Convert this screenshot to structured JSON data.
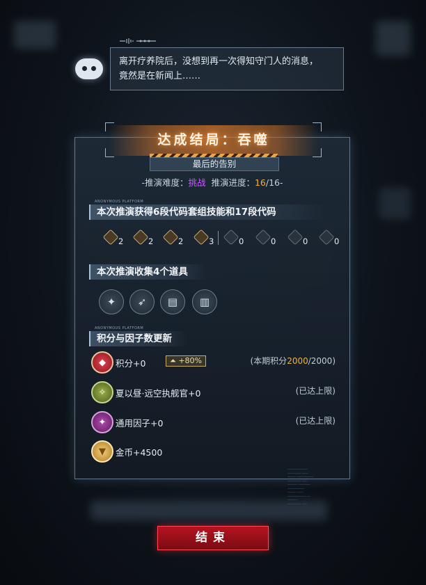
{
  "dialog": {
    "line1": "离开疗养院后，没想到再一次得知守门人的消息，",
    "line2": "竟然是在新闻上……"
  },
  "panel": {
    "title": "达成结局：吞噬",
    "subtitle": "最后的告别",
    "difficulty_label": "-推演难度：",
    "difficulty_value": "挑战",
    "progress_label": "推演进度：",
    "progress_current": "16",
    "progress_total": "/16-",
    "section_tag": "ANONYMOUS PLATFORM",
    "skills_heading": "本次推演获得6段代码套组技能和17段代码",
    "skills": [
      {
        "icon": "code-set-icon-1",
        "count": "2"
      },
      {
        "icon": "code-set-icon-2",
        "count": "2"
      },
      {
        "icon": "code-set-icon-3",
        "count": "2"
      },
      {
        "icon": "code-set-icon-4",
        "count": "3"
      },
      {
        "icon": "code-icon-5",
        "count": "0"
      },
      {
        "icon": "code-icon-6",
        "count": "0"
      },
      {
        "icon": "code-icon-7",
        "count": "0"
      },
      {
        "icon": "code-icon-8",
        "count": "0"
      }
    ],
    "items_heading": "本次推演收集4个道具",
    "items": [
      "✦",
      "➶",
      "▤",
      "▥"
    ],
    "score_heading": "积分与因子数更新",
    "score": {
      "label": "积分+0",
      "boost": "+80%",
      "period_prefix": "(本期积分",
      "period_value": "2000",
      "period_suffix": "/2000)"
    },
    "officer": {
      "label": "夏以昼·远空执舰官+0",
      "status": "(已达上限)"
    },
    "factor": {
      "label": "通用因子+0",
      "status": "(已达上限)"
    },
    "coin": {
      "label": "金币+4500"
    }
  },
  "end_button": "结束",
  "colors": {
    "accent_orange": "#f1b23e",
    "difficulty_purple": "#c65bff",
    "button_red": "#b5131f"
  }
}
